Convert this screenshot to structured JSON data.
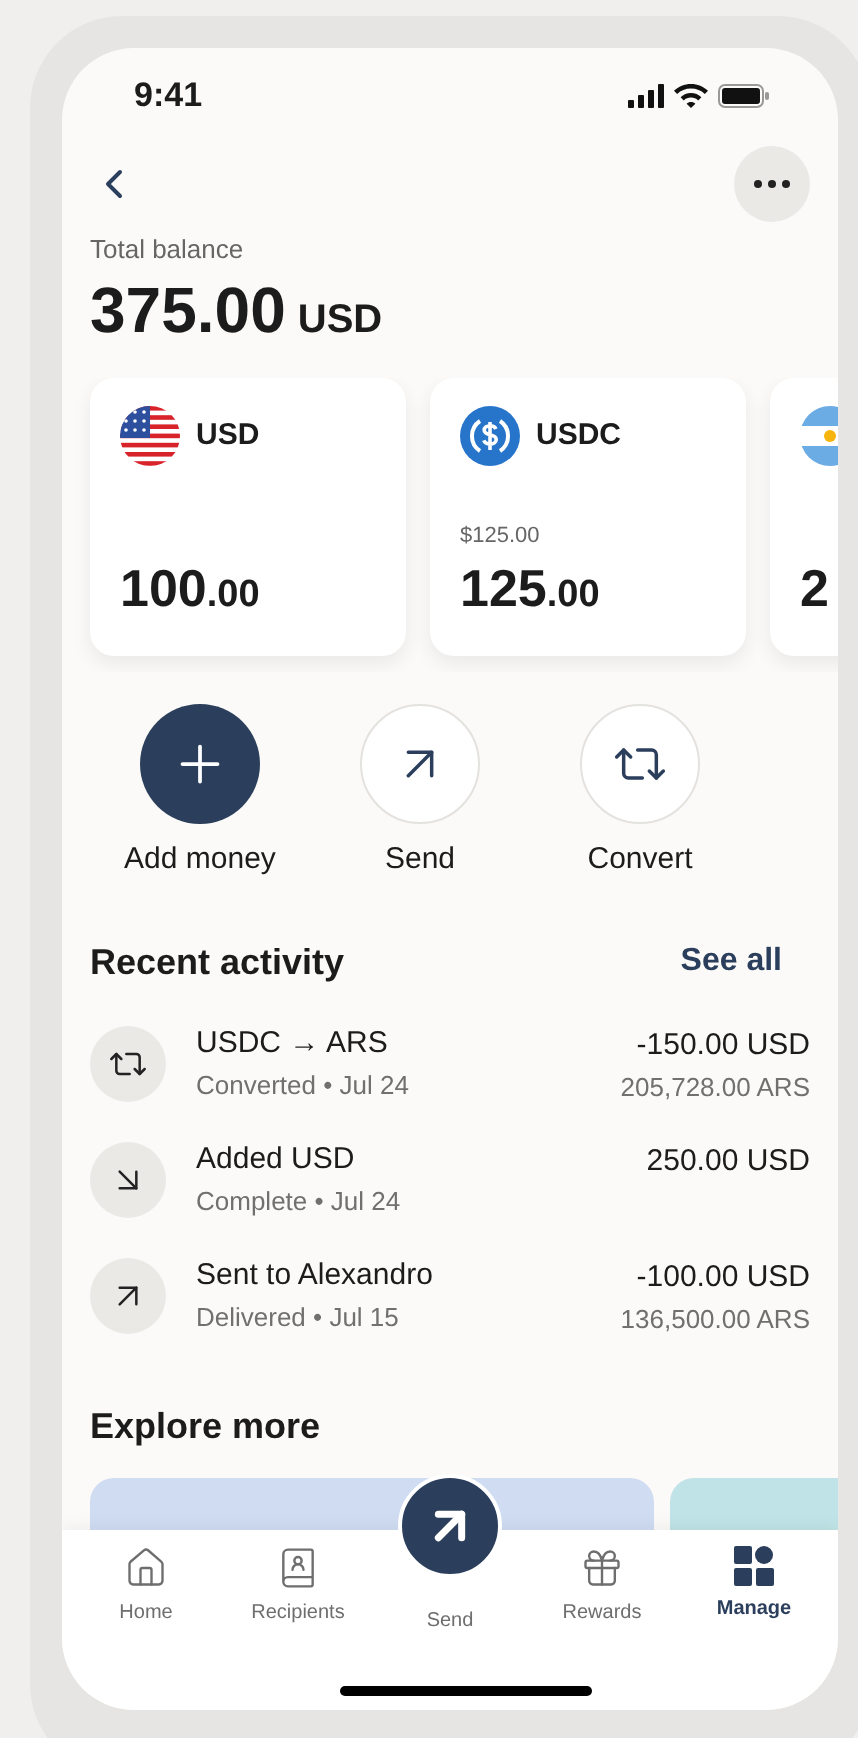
{
  "status_bar": {
    "time": "9:41"
  },
  "balance": {
    "label": "Total balance",
    "amount": "375.00",
    "currency": "USD"
  },
  "accounts": [
    {
      "kind": "flag-us",
      "code": "USD",
      "amount": "100",
      "decimals": ".00"
    },
    {
      "kind": "usdc",
      "code": "USDC",
      "sub": "$125.00",
      "amount": "125",
      "decimals": ".00"
    },
    {
      "kind": "flag-ar",
      "amount": "2"
    }
  ],
  "actions": [
    {
      "kind": "add",
      "label": "Add money"
    },
    {
      "kind": "send",
      "label": "Send"
    },
    {
      "kind": "convert",
      "label": "Convert"
    }
  ],
  "recent_activity": {
    "title": "Recent activity",
    "link": "See all",
    "items": [
      {
        "kind": "convert",
        "title": "USDC → ARS",
        "status": "Converted • Jul 24",
        "amount": "-150.00 USD",
        "secondary": "205,728.00 ARS"
      },
      {
        "kind": "added",
        "title": "Added USD",
        "status": "Complete • Jul 24",
        "amount": "250.00 USD"
      },
      {
        "kind": "sent",
        "title": "Sent to Alexandro",
        "status": "Delivered • Jul 15",
        "amount": "-100.00 USD",
        "secondary": "136,500.00 ARS"
      }
    ]
  },
  "explore": {
    "title": "Explore more",
    "cards": [
      {
        "color": "#cfdcf2"
      },
      {
        "color": "#bfe3e6"
      }
    ]
  },
  "nav": [
    {
      "kind": "home",
      "label": "Home",
      "selected": false
    },
    {
      "kind": "recipients",
      "label": "Recipients",
      "selected": false
    },
    {
      "kind": "send",
      "label": "Send",
      "selected": false
    },
    {
      "kind": "rewards",
      "label": "Rewards",
      "selected": false
    },
    {
      "kind": "manage",
      "label": "Manage",
      "selected": true
    }
  ]
}
